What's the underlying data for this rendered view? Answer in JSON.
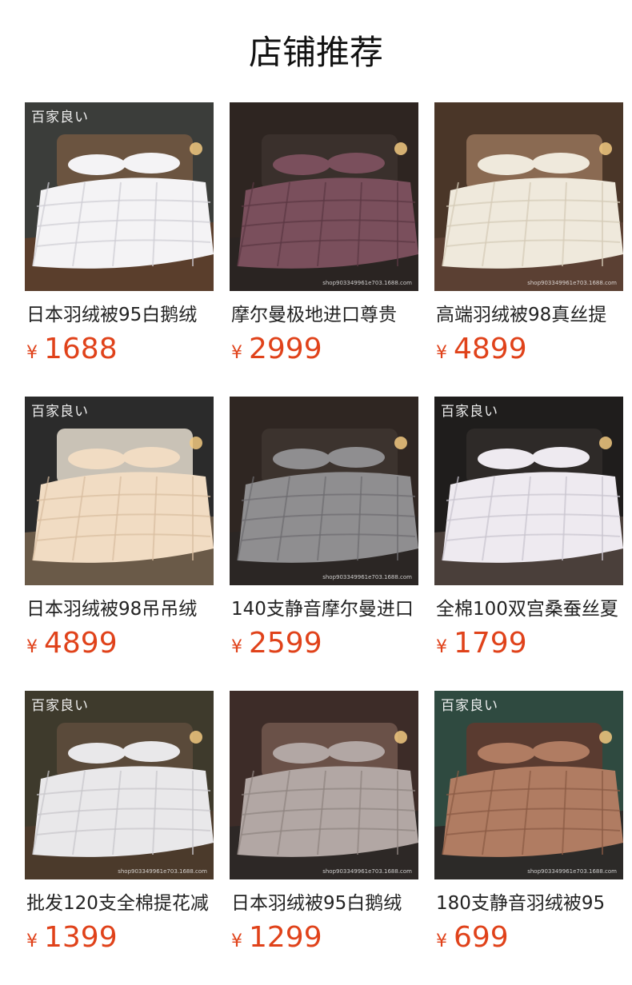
{
  "section": {
    "title": "店铺推荐"
  },
  "products": [
    {
      "title": "日本羽绒被95白鹅绒",
      "currency": "¥",
      "price": "1688",
      "brand_mark": "百家良い",
      "watermark": "",
      "image": "white-duvet-dark-bedroom"
    },
    {
      "title": "摩尔曼极地进口尊贵",
      "currency": "¥",
      "price": "2999",
      "brand_mark": "",
      "watermark": "shop903349961e703.1688.com",
      "image": "mauve-duvet-bedroom"
    },
    {
      "title": "高端羽绒被98真丝提",
      "currency": "¥",
      "price": "4899",
      "brand_mark": "",
      "watermark": "shop903349961e703.1688.com",
      "image": "ivory-silk-duvet-lakeview"
    },
    {
      "title": "日本羽绒被98吊吊绒",
      "currency": "¥",
      "price": "4899",
      "brand_mark": "百家良い",
      "watermark": "",
      "image": "cream-duvet-zebra-headboard"
    },
    {
      "title": "140支静音摩尔曼进口",
      "currency": "¥",
      "price": "2599",
      "brand_mark": "",
      "watermark": "shop903349961e703.1688.com",
      "image": "grey-duvet-bedroom"
    },
    {
      "title": "全棉100双宫桑蚕丝夏",
      "currency": "¥",
      "price": "1799",
      "brand_mark": "百家良い",
      "watermark": "",
      "image": "white-silk-duvet-dark-room"
    },
    {
      "title": "批发120支全棉提花减",
      "currency": "¥",
      "price": "1399",
      "brand_mark": "百家良い",
      "watermark": "shop903349961e703.1688.com",
      "image": "white-duvet-candles"
    },
    {
      "title": "日本羽绒被95白鹅绒",
      "currency": "¥",
      "price": "1299",
      "brand_mark": "",
      "watermark": "shop903349961e703.1688.com",
      "image": "taupe-duvet-bedroom"
    },
    {
      "title": "180支静音羽绒被95",
      "currency": "¥",
      "price": "699",
      "brand_mark": "百家良い",
      "watermark": "shop903349961e703.1688.com",
      "image": "paisley-duvet-green-wall"
    }
  ],
  "palette": {
    "price": "#e0421a",
    "images": [
      {
        "wall": "#3b3d3a",
        "floor": "#5a3e2c",
        "duvet": "#f4f3f5",
        "shade": "#cfcdd4",
        "headboard": "#6b5440"
      },
      {
        "wall": "#2e2521",
        "floor": "#2a2422",
        "duvet": "#7a4f5c",
        "shade": "#5b3843",
        "headboard": "#3a302c"
      },
      {
        "wall": "#4a3628",
        "floor": "#5b4033",
        "duvet": "#efe9dc",
        "shade": "#d4cab6",
        "headboard": "#8a6a52"
      },
      {
        "wall": "#2b2b2b",
        "floor": "#6a5a48",
        "duvet": "#f1dcc3",
        "shade": "#d8bda0",
        "headboard": "#c9c2b6"
      },
      {
        "wall": "#2f2622",
        "floor": "#2b2624",
        "duvet": "#8f8e90",
        "shade": "#6d6c70",
        "headboard": "#3c332e"
      },
      {
        "wall": "#1f1d1c",
        "floor": "#4a3f3a",
        "duvet": "#eeeaf0",
        "shade": "#c9c4cf",
        "headboard": "#2e2a28"
      },
      {
        "wall": "#3e3a2c",
        "floor": "#4b3a2b",
        "duvet": "#e9e8ea",
        "shade": "#c8c6cb",
        "headboard": "#5a4a3a"
      },
      {
        "wall": "#3d2c28",
        "floor": "#2d2826",
        "duvet": "#b2a7a4",
        "shade": "#8f8480",
        "headboard": "#6a5148"
      },
      {
        "wall": "#2f4a40",
        "floor": "#2c2a28",
        "duvet": "#b07c62",
        "shade": "#8a5a44",
        "headboard": "#5a3b30"
      }
    ]
  }
}
